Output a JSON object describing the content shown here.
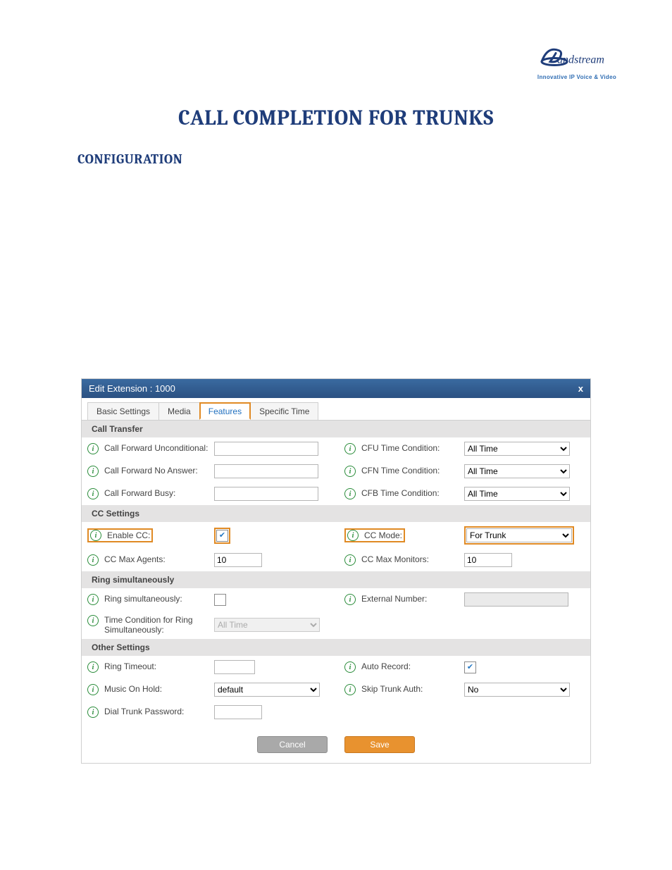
{
  "brand": {
    "name": "Grandstream",
    "tagline": "Innovative IP Voice & Video"
  },
  "doc_title": "CALL COMPLETION FOR TRUNKS",
  "section_title": "CONFIGURATION",
  "dialog": {
    "title": "Edit Extension : 1000",
    "close": "x",
    "tabs": {
      "basic": "Basic Settings",
      "media": "Media",
      "features": "Features",
      "specific": "Specific Time"
    },
    "groups": {
      "transfer": {
        "title": "Call Transfer",
        "cfu_label": "Call Forward Unconditional:",
        "cfu_value": "",
        "cfu_tc_label": "CFU Time Condition:",
        "cfu_tc_value": "All Time",
        "cfna_label": "Call Forward No Answer:",
        "cfna_value": "",
        "cfna_tc_label": "CFN Time Condition:",
        "cfna_tc_value": "All Time",
        "cfb_label": "Call Forward Busy:",
        "cfb_value": "",
        "cfb_tc_label": "CFB Time Condition:",
        "cfb_tc_value": "All Time"
      },
      "cc": {
        "title": "CC Settings",
        "enable_label": "Enable CC:",
        "mode_label": "CC Mode:",
        "mode_value": "For Trunk",
        "agents_label": "CC Max Agents:",
        "agents_value": "10",
        "monitors_label": "CC Max Monitors:",
        "monitors_value": "10"
      },
      "ring": {
        "title": "Ring simultaneously",
        "ring_label": "Ring simultaneously:",
        "ext_label": "External Number:",
        "ext_value": "",
        "tc_label": "Time Condition for Ring Simultaneously:",
        "tc_value": "All Time"
      },
      "other": {
        "title": "Other Settings",
        "rt_label": "Ring Timeout:",
        "rt_value": "",
        "ar_label": "Auto Record:",
        "moh_label": "Music On Hold:",
        "moh_value": "default",
        "sta_label": "Skip Trunk Auth:",
        "sta_value": "No",
        "dtp_label": "Dial Trunk Password:",
        "dtp_value": ""
      }
    },
    "buttons": {
      "cancel": "Cancel",
      "save": "Save"
    }
  }
}
